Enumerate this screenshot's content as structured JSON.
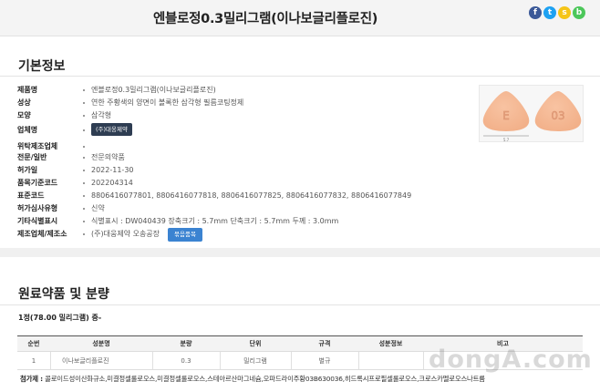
{
  "header": {
    "title": "엔블로정0.3밀리그램(이나보글리플로진)",
    "share_icons": [
      {
        "name": "facebook-icon",
        "glyph": "f",
        "color": "#3b5998"
      },
      {
        "name": "twitter-icon",
        "glyph": "t",
        "color": "#1da1f2"
      },
      {
        "name": "kakaostory-icon",
        "glyph": "s",
        "color": "#f5c518"
      },
      {
        "name": "band-icon",
        "glyph": "b",
        "color": "#4cc75a"
      }
    ]
  },
  "basic_info": {
    "section_title": "기본정보",
    "rows": [
      {
        "label": "제품명",
        "value": "엔블로정0.3밀리그램(이나보글리플로진)"
      },
      {
        "label": "성상",
        "value": "연한 주황색의 양면이 볼록한 삼각형 필름코팅정제"
      },
      {
        "label": "모양",
        "value": "삼각형"
      },
      {
        "label": "업체명",
        "value": "",
        "button": "(주)대웅제약"
      },
      {
        "label": "위탁제조업체",
        "value": ""
      },
      {
        "label": "전문/일반",
        "value": "전문의약품"
      },
      {
        "label": "허가일",
        "value": "2022-11-30"
      },
      {
        "label": "품목기준코드",
        "value": "202204314"
      },
      {
        "label": "표준코드",
        "value": "8806416077801, 8806416077818, 8806416077825, 8806416077832, 8806416077849"
      },
      {
        "label": "허가심사유형",
        "value": "신약"
      },
      {
        "label": "기타식별표시",
        "value": "식별표시 : DW040439 장축크기 : 5.7mm 단축크기 : 5.7mm 두께 : 3.0mm"
      },
      {
        "label": "제조업체/제조소",
        "value": "(주)대웅제약 오송공장",
        "button": "묶음품목"
      }
    ],
    "pill_image": {
      "front_mark": "E",
      "back_mark": "03",
      "pill_color": "#f2b089",
      "dimension_label": "5.7"
    }
  },
  "ingredients": {
    "section_title": "원료약품 및 분량",
    "count_line": "1정(78.00 밀리그램) 중-",
    "columns": [
      "순번",
      "성분명",
      "분량",
      "단위",
      "규격",
      "성분정보",
      "비고"
    ],
    "rows": [
      [
        "1",
        "이나보글리플로진",
        "0.3",
        "밀리그램",
        "별규",
        "",
        ""
      ]
    ],
    "additives_label": "첨가제 :",
    "additives": "콜로이드성이산화규소,미결정셀룰로오스,미결정셀룰로오스,스테아르산마그네슘,오파드라이주황03B630036,히드록시프로필셀룰로오스,크로스카멜로오스나트륨"
  },
  "watermark": "dongA.com"
}
